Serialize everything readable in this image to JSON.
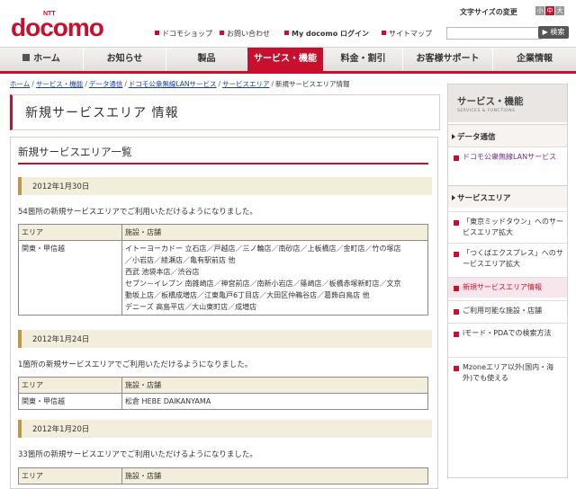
{
  "header": {
    "logo_ntt": "NTT",
    "logo_text": "docomo",
    "font_size_label": "文字サイズの変更",
    "font_sizes": [
      "小",
      "中",
      "大"
    ],
    "links": [
      "ドコモショップ",
      "お問い合わせ",
      "My docomo ログイン",
      "サイトマップ"
    ],
    "search_placeholder": "",
    "search_button": "▶ 検索"
  },
  "nav": {
    "items": [
      "ホーム",
      "お知らせ",
      "製品",
      "サービス・機能",
      "料金・割引",
      "お客様サポート",
      "企業情報"
    ],
    "active_index": 3
  },
  "breadcrumb": [
    "ホーム",
    "サービス・機能",
    "データ通信",
    "ドコモ公衆無線LANサービス",
    "サービスエリア",
    "新規サービスエリア情報"
  ],
  "main": {
    "page_title": "新規サービスエリア 情報",
    "section_title": "新規サービスエリア一覧",
    "entries": [
      {
        "date": "2012年1月30日",
        "note": "54箇所の新規サービスエリアでご利用いただけるようになりました。",
        "col_area": "エリア",
        "col_facility": "施設・店舗",
        "area": "関東・甲信越",
        "facilities": [
          "イトーヨーカドー 立石店／戸越店／三ノ輪店／南砂店／上板橋店／金町店／竹の塚店",
          "／小岩店／綾瀬店／亀有駅前店 他",
          "西武 池袋本店／渋谷店",
          "セブン－イレブン 南雑崎店／神宮前店／南新小岩店／篠崎店／板橋赤塚新町店／文京",
          "動坂上店／板橋成増店／江東亀戸6丁目店／大田区仲鵜谷店／葛飾白鳥店 他",
          "デニーズ 高島平店／大山東町店／成増店"
        ]
      },
      {
        "date": "2012年1月24日",
        "note": "1箇所の新規サービスエリアでご利用いただけるようになりました。",
        "col_area": "エリア",
        "col_facility": "施設・店舗",
        "area": "関東・甲信越",
        "facilities": [
          "松倉 HEBE DAIKANYAMA"
        ]
      },
      {
        "date": "2012年1月20日",
        "note": "33箇所の新規サービスエリアでご利用いただけるようになりました。",
        "col_area": "エリア",
        "col_facility": "施設・店舗"
      }
    ]
  },
  "sidebar": {
    "title": "サービス・機能",
    "subtitle": "SERVICES & FUNCTIONS",
    "cat1": "データ通信",
    "item_wlan": "ドコモ公衆無線LANサービス",
    "cat2": "サービスエリア",
    "items": [
      "「東京ミッドタウン」へのサービスエリア拡大",
      "「つくばエクスプレス」へのサービスエリア拡大",
      "新規サービスエリア情報",
      "ご利用可能な施設・店舗",
      "iモード・PDAでの検索方法",
      "Mzoneエリア以外(国内・海外)でも使える"
    ]
  },
  "colors": {
    "brand": "#c8102e",
    "accent_bar": "#b89a4a",
    "date_bg": "#f2eedb"
  }
}
